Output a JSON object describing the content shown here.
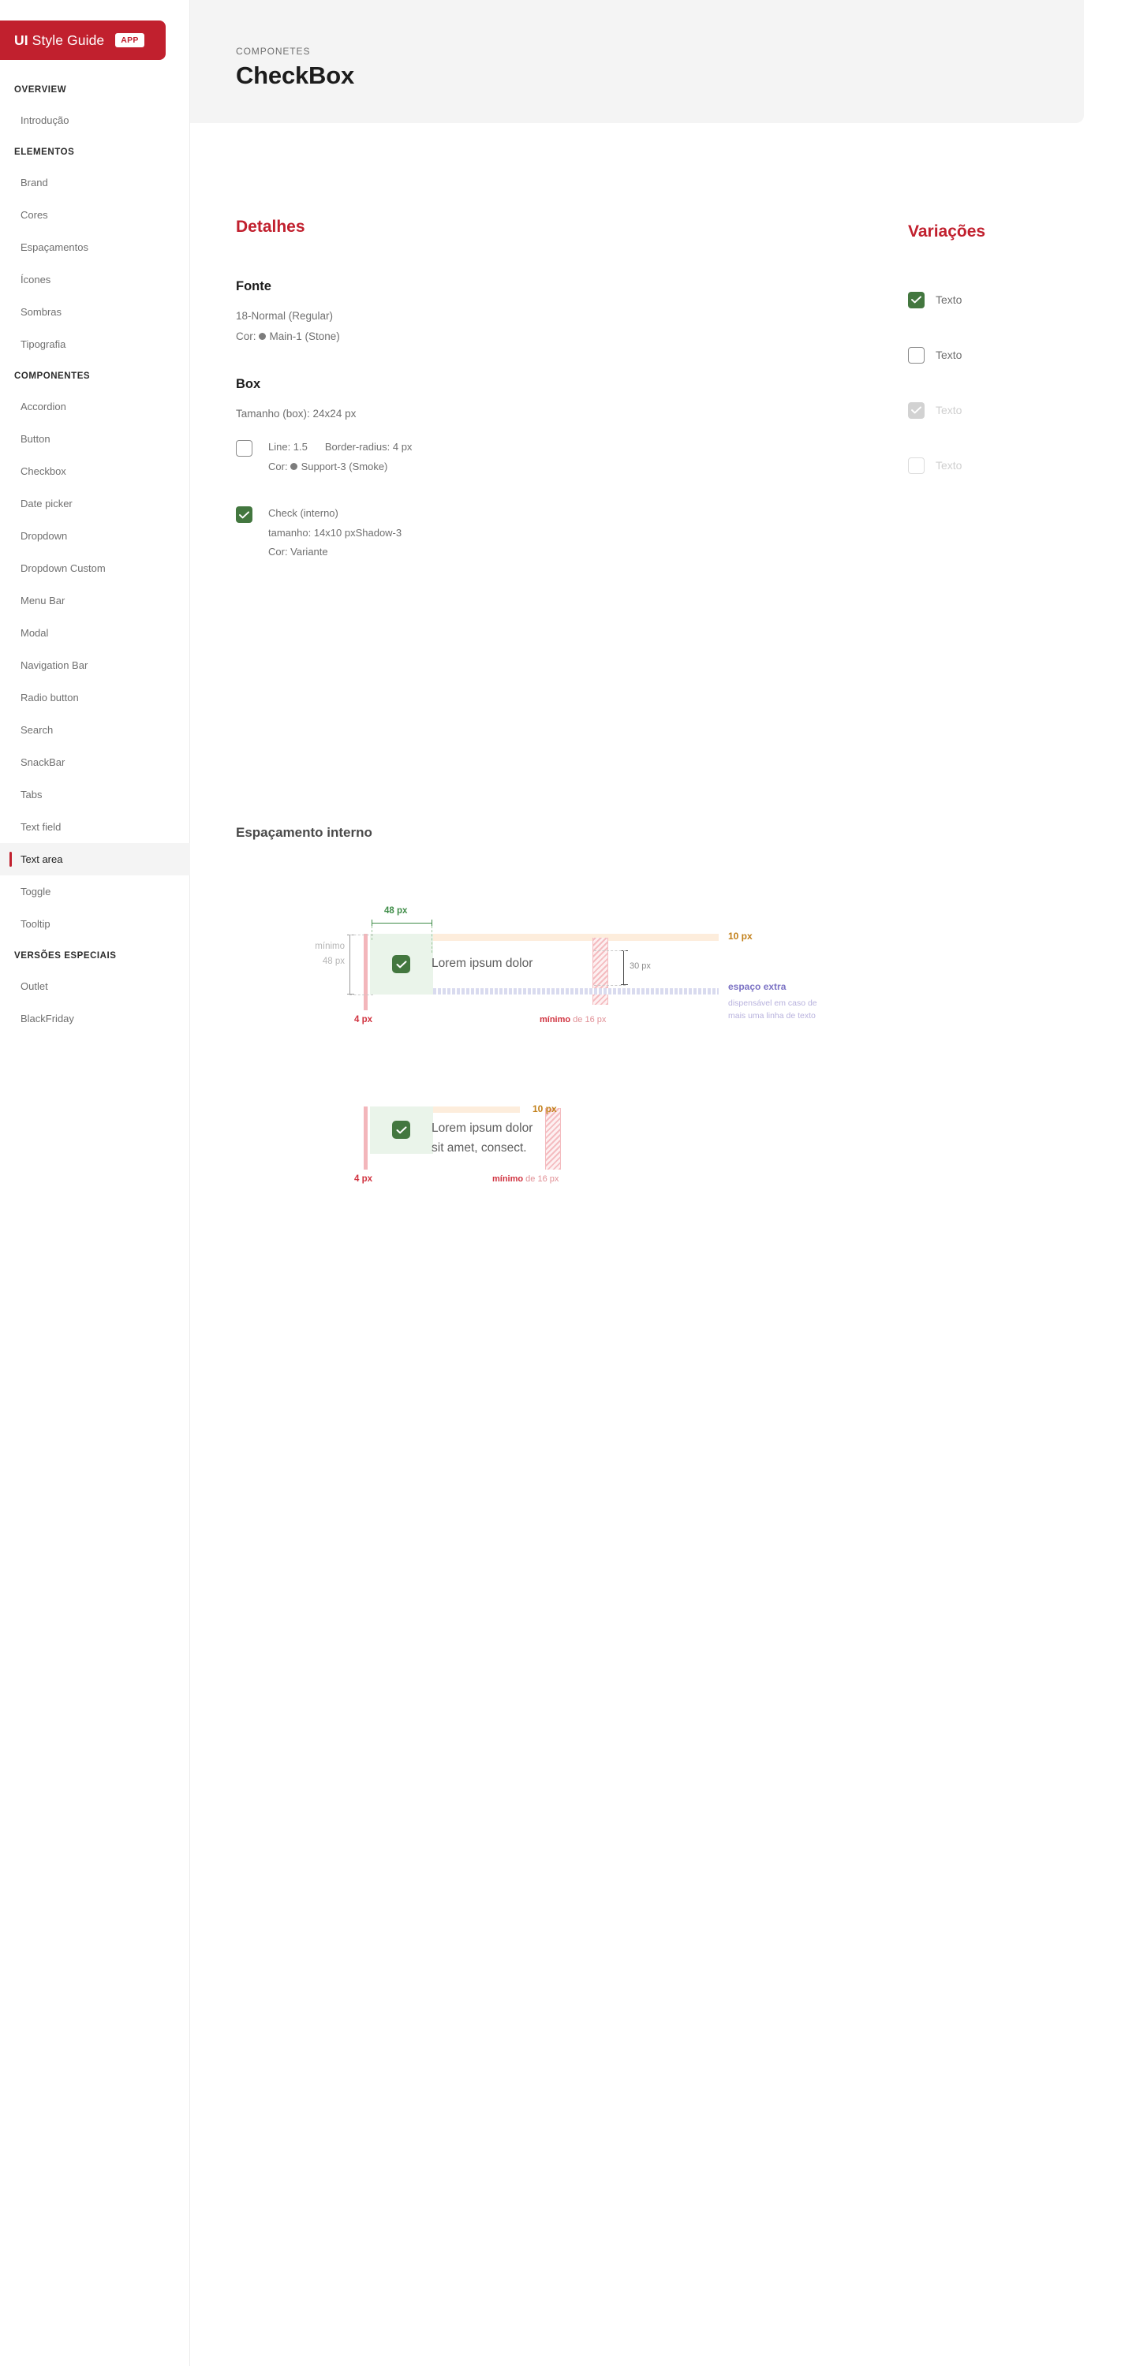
{
  "brand": {
    "name_bold": "UI",
    "name_light": " Style Guide",
    "badge": "APP",
    "color": "#c1202e"
  },
  "sidebar": {
    "groups": [
      {
        "title": "OVERVIEW",
        "items": [
          {
            "label": "Introdução",
            "active": false
          }
        ]
      },
      {
        "title": "ELEMENTOS",
        "items": [
          {
            "label": "Brand",
            "active": false
          },
          {
            "label": "Cores",
            "active": false
          },
          {
            "label": "Espaçamentos",
            "active": false
          },
          {
            "label": "Ícones",
            "active": false
          },
          {
            "label": "Sombras",
            "active": false
          },
          {
            "label": "Tipografia",
            "active": false
          }
        ]
      },
      {
        "title": "COMPONENTES",
        "items": [
          {
            "label": "Accordion",
            "active": false
          },
          {
            "label": "Button",
            "active": false
          },
          {
            "label": "Checkbox",
            "active": false
          },
          {
            "label": "Date picker",
            "active": false
          },
          {
            "label": "Dropdown",
            "active": false
          },
          {
            "label": "Dropdown Custom",
            "active": false
          },
          {
            "label": "Menu Bar",
            "active": false
          },
          {
            "label": "Modal",
            "active": false
          },
          {
            "label": "Navigation Bar",
            "active": false
          },
          {
            "label": "Radio button",
            "active": false
          },
          {
            "label": "Search",
            "active": false
          },
          {
            "label": "SnackBar",
            "active": false
          },
          {
            "label": "Tabs",
            "active": false
          },
          {
            "label": "Text field",
            "active": false
          },
          {
            "label": "Text area",
            "active": true
          },
          {
            "label": "Toggle",
            "active": false
          },
          {
            "label": "Tooltip",
            "active": false
          }
        ]
      },
      {
        "title": "VERSÕES ESPECIAIS",
        "items": [
          {
            "label": "Outlet",
            "active": false
          },
          {
            "label": "BlackFriday",
            "active": false
          }
        ]
      }
    ]
  },
  "header": {
    "eyebrow": "COMPONETES",
    "title": "CheckBox"
  },
  "detalhes": {
    "title": "Detalhes",
    "fonte": {
      "heading": "Fonte",
      "size_line": "18-Normal (Regular)",
      "cor_label": "Cor:",
      "cor_value": "Main-1 (Stone)"
    },
    "box": {
      "heading": "Box",
      "tamanho": "Tamanho (box): 24x24 px",
      "outer": {
        "line": "Line: 1.5",
        "border_radius": "Border-radius: 4 px",
        "cor_label": "Cor:",
        "cor_value": "Support-3 (Smoke)"
      },
      "inner": {
        "title": "Check (interno)",
        "tamanho": "tamanho: 14x10 px",
        "shadow": "Shadow-3",
        "cor": "Cor: Variante"
      }
    }
  },
  "variacoes": {
    "title": "Variações",
    "items": [
      {
        "label": "Texto",
        "state": "checked"
      },
      {
        "label": "Texto",
        "state": "empty"
      },
      {
        "label": "Texto",
        "state": "disabled-checked"
      },
      {
        "label": "Texto",
        "state": "disabled-empty"
      }
    ]
  },
  "espacamento": {
    "title": "Espaçamento interno",
    "diagram1": {
      "top_measure": "48 px",
      "left_min_1": "mínimo",
      "left_min_2": "48 px",
      "left_pad": "4 px",
      "min_gap_bold": "mínimo",
      "min_gap_rest": " de 16 px",
      "top_pad": "10 px",
      "inner_height": "30 px",
      "extra_title": "espaço extra",
      "extra_desc_1": "dispensável em caso de",
      "extra_desc_2": "mais uma linha de texto",
      "demo_text": "Lorem ipsum dolor"
    },
    "diagram2": {
      "top_pad": "10 px",
      "left_pad": "4 px",
      "min_gap_bold": "mínimo",
      "min_gap_rest": " de 16 px",
      "demo_text_line1": "Lorem ipsum dolor",
      "demo_text_line2": "sit amet, consect."
    }
  },
  "colors": {
    "brand_red": "#c1202e",
    "accent_green": "#43773f",
    "text_main": "#1c1c1c",
    "text_muted": "#6f6f6f",
    "header_bg": "#f4f4f4"
  }
}
